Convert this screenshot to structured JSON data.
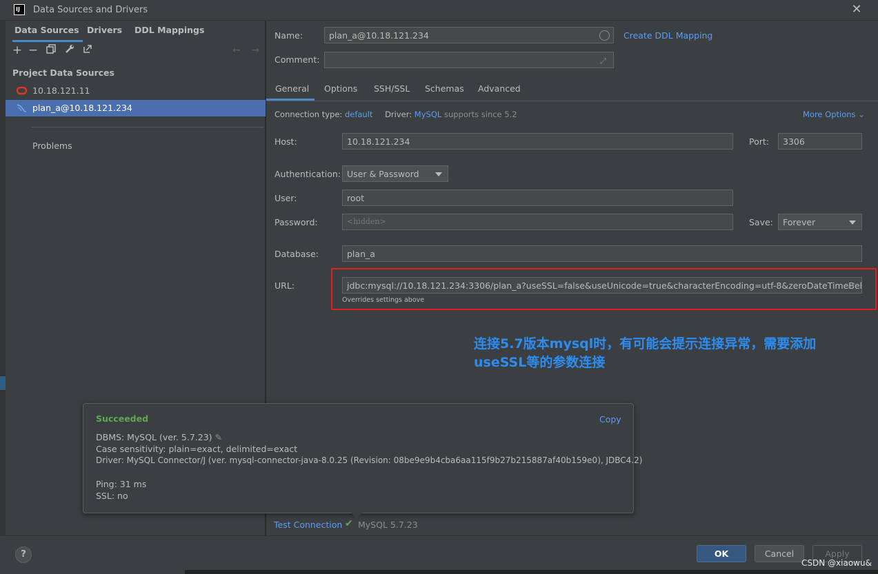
{
  "window": {
    "title": "Data Sources and Drivers",
    "logo": "IJ",
    "close_glyph": "✕"
  },
  "left_panel": {
    "tabs": [
      "Data Sources",
      "Drivers",
      "DDL Mappings"
    ],
    "toolbar": [
      "add-icon",
      "remove-icon",
      "copy-icon",
      "wrench-icon",
      "jump-to-icon",
      "back-arrow-icon",
      "forward-arrow-icon"
    ],
    "section_title": "Project Data Sources",
    "items": [
      {
        "label": "10.18.121.11",
        "icon": "oracle-icon",
        "selected": false
      },
      {
        "label": "plan_a@10.18.121.234",
        "icon": "mysql-icon",
        "selected": true
      }
    ],
    "problems": "Problems"
  },
  "form": {
    "name_label": "Name:",
    "name_value": "plan_a@10.18.121.234",
    "create_ddl": "Create DDL Mapping",
    "comment_label": "Comment:",
    "comment_value": "",
    "tabs": [
      "General",
      "Options",
      "SSH/SSL",
      "Schemas",
      "Advanced"
    ],
    "conn_type_label": "Connection type:",
    "conn_type_value": "default",
    "driver_label": "Driver:",
    "driver_value": "MySQL",
    "driver_note": "supports since 5.2",
    "more_options": "More Options ⌄",
    "host_label": "Host:",
    "host_value": "10.18.121.234",
    "port_label": "Port:",
    "port_value": "3306",
    "auth_label": "Authentication:",
    "auth_value": "User & Password",
    "user_label": "User:",
    "user_value": "root",
    "password_label": "Password:",
    "password_value": "<hidden>",
    "save_label": "Save:",
    "save_value": "Forever",
    "database_label": "Database:",
    "database_value": "plan_a",
    "url_label": "URL:",
    "url_value": "jdbc:mysql://10.18.121.234:3306/plan_a?useSSL=false&useUnicode=true&characterEncoding=utf-8&zeroDateTimeBehavior=",
    "url_note": "Overrides settings above"
  },
  "annotation": {
    "line1": "连接5.7版本mysql时，有可能会提示连接异常，需要添加",
    "line2": "useSSL等的参数连接",
    "color": "#2d8cf0"
  },
  "popup": {
    "status": "Succeeded",
    "copy": "Copy",
    "dbms": "DBMS: MySQL (ver. 5.7.23)",
    "case": "Case sensitivity: plain=exact, delimited=exact",
    "driver": "Driver: MySQL Connector/J (ver. mysql-connector-java-8.0.25 (Revision: 08be9e9b4cba6aa115f9b27b215887af40b159e0), JDBC4.2)",
    "ping": "Ping: 31 ms",
    "ssl": "SSL: no"
  },
  "footer": {
    "test_connection": "Test Connection",
    "test_result": "MySQL 5.7.23",
    "help": "?",
    "ok": "OK",
    "cancel": "Cancel",
    "apply": "Apply",
    "watermark": "CSDN @xiaowu&"
  }
}
